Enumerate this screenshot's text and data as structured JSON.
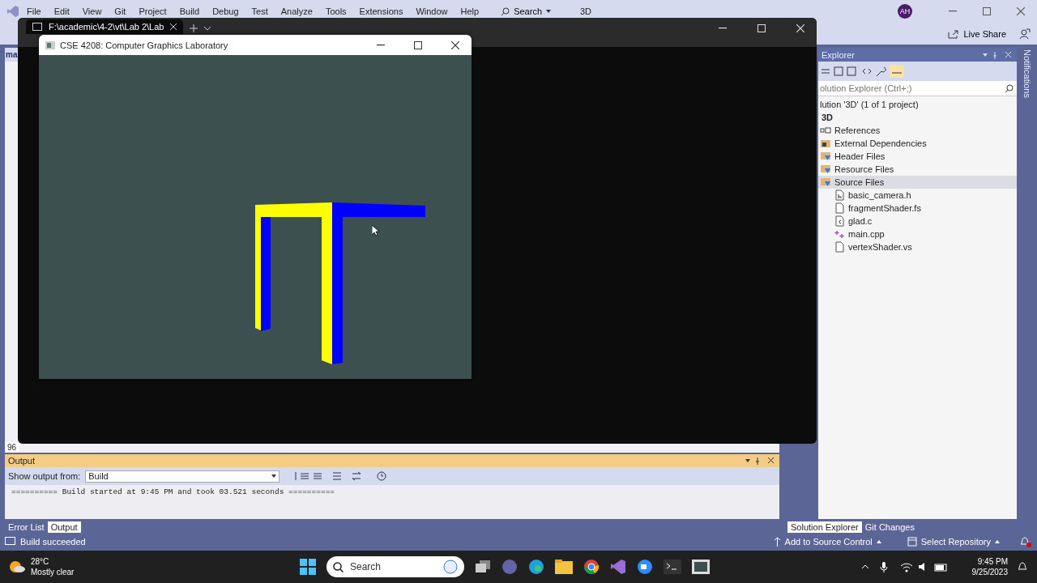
{
  "ide": {
    "menu": [
      "File",
      "Edit",
      "View",
      "Git",
      "Project",
      "Build",
      "Debug",
      "Test",
      "Analyze",
      "Tools",
      "Extensions",
      "Window",
      "Help"
    ],
    "search": "Search",
    "solution_name": "3D",
    "avatar": "AH",
    "live_share": "Live Share"
  },
  "editor": {
    "tab": "ma",
    "zoom": "96"
  },
  "terminal": {
    "tab_title": "F:\\academic\\4-2\\vt\\Lab 2\\Lab"
  },
  "gl_window": {
    "title": "CSE 4208: Computer Graphics Laboratory"
  },
  "output": {
    "title": "Output",
    "source_label": "Show output from:",
    "source": "Build",
    "lines": [
      "========== Build started at 9:45 PM and took 03.521 seconds =========="
    ]
  },
  "bottom_tabs": [
    {
      "label": "Error List",
      "selected": false
    },
    {
      "label": "Output",
      "selected": true
    }
  ],
  "solution_explorer": {
    "title": "Explorer",
    "search_placeholder": "olution Explorer (Ctrl+;)",
    "tree": [
      {
        "label": "lution '3D' (1 of 1 project)",
        "selected": false,
        "children": [
          {
            "label": "3D",
            "kind": "project",
            "selected": false,
            "children": [
              {
                "label": "References",
                "kind": "references",
                "selected": false
              },
              {
                "label": "External Dependencies",
                "kind": "external",
                "selected": false
              },
              {
                "label": "Header Files",
                "kind": "filter",
                "selected": false
              },
              {
                "label": "Resource Files",
                "kind": "filter",
                "selected": false
              },
              {
                "label": "Source Files",
                "kind": "filter",
                "selected": true,
                "children": [
                  {
                    "label": "basic_camera.h",
                    "kind": "header",
                    "selected": false
                  },
                  {
                    "label": "fragmentShader.fs",
                    "kind": "file",
                    "selected": false
                  },
                  {
                    "label": "glad.c",
                    "kind": "c",
                    "selected": false
                  },
                  {
                    "label": "main.cpp",
                    "kind": "cpp",
                    "selected": false
                  },
                  {
                    "label": "vertexShader.vs",
                    "kind": "file",
                    "selected": false
                  }
                ]
              }
            ]
          }
        ]
      }
    ]
  },
  "side_tabs": [
    {
      "label": "Solution Explorer",
      "selected": true
    },
    {
      "label": "Git Changes",
      "selected": false
    }
  ],
  "notifications": "Notifications",
  "status_bar": {
    "message": "Build succeeded",
    "source_control": "Add to Source Control",
    "repository": "Select Repository"
  },
  "taskbar": {
    "temperature": "28°C",
    "weather": "Mostly clear",
    "search": "Search",
    "time": "9:45 PM",
    "date": "9/25/2023"
  }
}
